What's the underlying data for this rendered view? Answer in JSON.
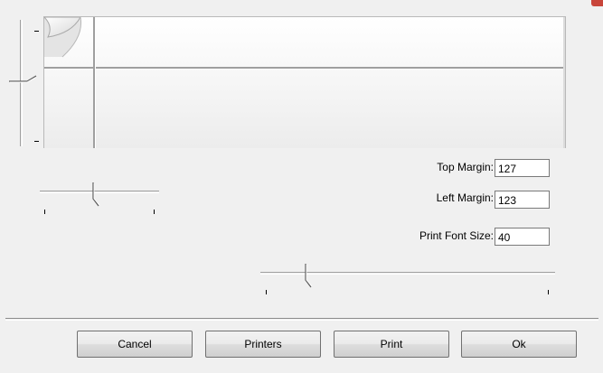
{
  "window": {
    "close_glyph": "close-icon"
  },
  "colors": {
    "close_accent": "#c8453a",
    "preview_line": "#9f9f9f"
  },
  "vertical_slider": {
    "value_fraction": 0.45
  },
  "horizontal_slider_left": {
    "value_fraction": 0.45
  },
  "horizontal_slider_bottom": {
    "value_fraction": 0.15
  },
  "fields": {
    "top_margin": {
      "label": "Top Margin:",
      "value": "127"
    },
    "left_margin": {
      "label": "Left Margin:",
      "value": "123"
    },
    "print_font_size": {
      "label": "Print Font Size:",
      "value": "40"
    }
  },
  "buttons": {
    "cancel": "Cancel",
    "printers": "Printers",
    "print": "Print",
    "ok": "Ok"
  }
}
